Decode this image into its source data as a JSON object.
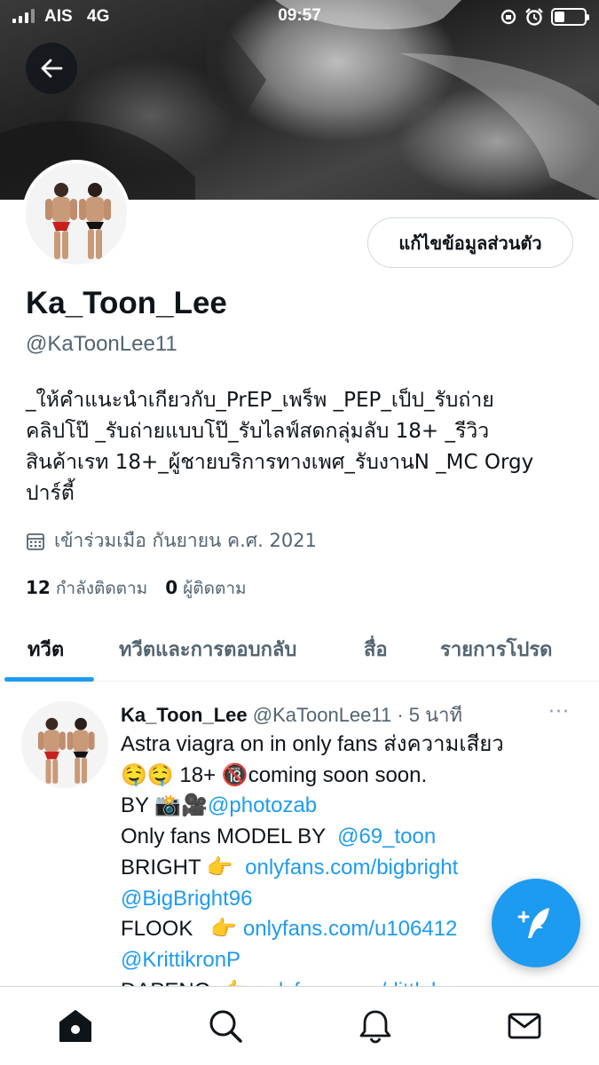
{
  "status_bar": {
    "carrier": "AIS",
    "network": "4G",
    "time": "09:57",
    "battery_level": 0.35
  },
  "profile": {
    "display_name": "Ka_Toon_Lee",
    "handle": "@KaToonLee11",
    "edit_button_label": "แก้ไขข้อมูลส่วนตัว",
    "bio_lines": [
      "_ให้คำแนะนำเกียวกับ_PrEP_เพร็พ _PEP_เป็ป_รับถ่าย",
      "คลิปโป๊ _รับถ่ายแบบโป๊_รับไลฟ์สดกลุ่มลับ 18+ _รีวิว",
      "สินค้าเรท 18+_ผู้ชายบริการทางเพศ_รับงานN _MC Orgy",
      "ปาร์ตี้"
    ],
    "joined": "เข้าร่วมเมือ กันยายน ค.ศ. 2021",
    "following_count": "12",
    "following_label": "กำลังติดตาม",
    "followers_count": "0",
    "followers_label": "ผู้ติดตาม"
  },
  "tabs": [
    {
      "label": "ทวีต",
      "active": true
    },
    {
      "label": "ทวีตและการตอบกลับ",
      "active": false
    },
    {
      "label": "สื่อ",
      "active": false
    },
    {
      "label": "รายการโปรด",
      "active": false
    }
  ],
  "tweet": {
    "name": "Ka_Toon_Lee",
    "handle_time": "@KaToonLee11 · 5 นาที",
    "more": "···",
    "line1": "Astra viagra  on in only fans ส่งความเสียว",
    "line2_text": "🤤🤤 18+ 🔞coming soon soon.",
    "line3_prefix": "BY  📸🎥",
    "line3_link": "@photozab",
    "line4_prefix": "Only fans MODEL BY  ",
    "line4_link": "@69_toon",
    "line5_prefix": "BRIGHT 👉  ",
    "line5_link": "onlyfans.com/bigbright",
    "line6_link": "@BigBright96",
    "line7_prefix": "FLOOK   👉 ",
    "line7_link": "onlyfans.com/u106412",
    "line8_link": "@KrittikronP",
    "line9_prefix": "DAPENG  👉 ",
    "line9_link": "onlyfans.com/dittlebo"
  },
  "icons": {
    "back": "arrow-left-icon",
    "calendar": "calendar-icon",
    "compose": "compose-feather-icon",
    "nav": [
      "home-icon",
      "search-icon",
      "notifications-icon",
      "messages-icon"
    ]
  },
  "colors": {
    "accent": "#1d9bf0",
    "text": "#0f1419",
    "muted": "#536471"
  }
}
